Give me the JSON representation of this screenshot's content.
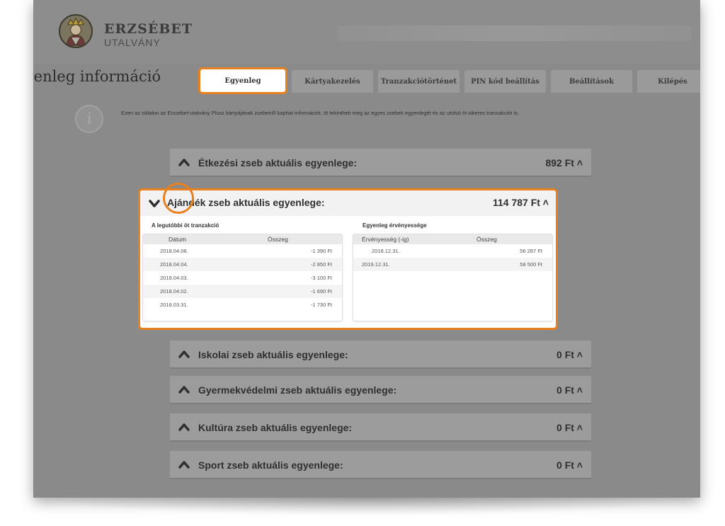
{
  "brand": {
    "name": "ERZSÉBET",
    "sub": "UTALVÁNY"
  },
  "page": {
    "title": "Egyenleg információ"
  },
  "tabs": [
    {
      "label": "Egyenleg",
      "active": true
    },
    {
      "label": "Kártyakezelés"
    },
    {
      "label": "Tranzakciótörténet"
    },
    {
      "label": "PIN kód beállítás"
    },
    {
      "label": "Beállítások"
    },
    {
      "label": "Kilépés"
    }
  ],
  "info": {
    "text": "Ezen az oldalon az Erzsébet-utalvány Plusz kártyájának zsebeiről kaphat információt. Itt tekintheti meg az egyes zsebek egyenlegét és az utolsó öt sikeres tranzakciót is."
  },
  "pockets": [
    {
      "title": "Étkezési zseb aktuális egyenlege:",
      "amount": "892 Ft ˄"
    },
    {
      "title": "Ajándék zseb aktuális egyenlege:",
      "amount": "114 787 Ft ˄",
      "expanded": true
    },
    {
      "title": "Iskolai zseb aktuális egyenlege:",
      "amount": "0 Ft ˄"
    },
    {
      "title": "Gyermekvédelmi zseb aktuális egyenlege:",
      "amount": "0 Ft ˄"
    },
    {
      "title": "Kultúra zseb aktuális egyenlege:",
      "amount": "0 Ft ˄"
    },
    {
      "title": "Sport zseb aktuális egyenlege:",
      "amount": "0 Ft ˄"
    }
  ],
  "transactions": {
    "label": "A legutóbbi öt tranzakció",
    "headers": [
      "Dátum",
      "Összeg"
    ],
    "rows": [
      {
        "date": "2018.04.08.",
        "amount": "-1 390 Ft"
      },
      {
        "date": "2018.04.04.",
        "amount": "-2 850 Ft"
      },
      {
        "date": "2018.04.03.",
        "amount": "-3 100 Ft"
      },
      {
        "date": "2018.04.02.",
        "amount": "-1 690 Ft"
      },
      {
        "date": "2018.03.31.",
        "amount": "-1 730 Ft"
      }
    ]
  },
  "validity": {
    "label": "Egyenleg érvényessége",
    "headers": [
      "Érvényesség (-ig)",
      "Összeg"
    ],
    "rows": [
      {
        "date": "2018.12.31.",
        "amount": "56 287 Ft"
      },
      {
        "date": "2019.12.31.",
        "amount": "58 500 Ft"
      }
    ]
  },
  "colors": {
    "accent": "#e8811d",
    "overlay": "#8a8a8a"
  },
  "icons": {
    "expand": "chevron-down-icon",
    "collapse": "chevron-up-icon",
    "info": "info-icon",
    "logo": "queen-emblem-icon"
  }
}
